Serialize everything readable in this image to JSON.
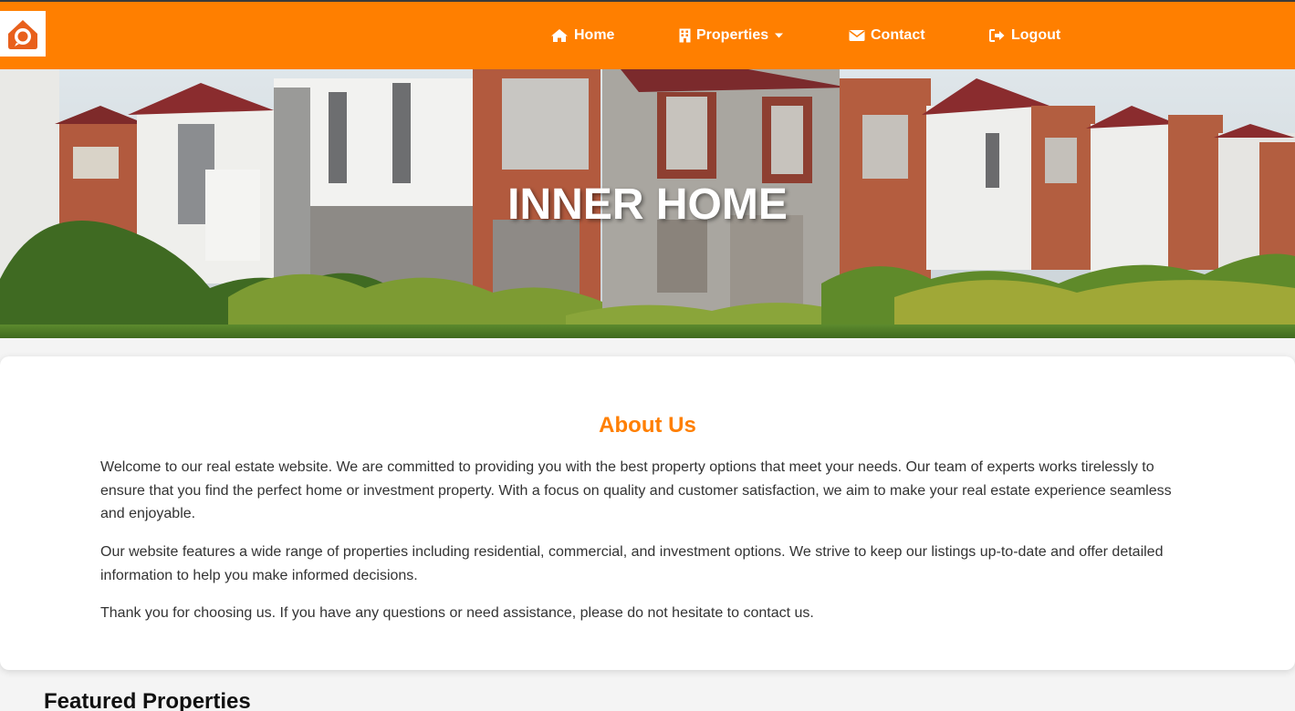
{
  "colors": {
    "accent": "#ff7f00",
    "nav_text": "#ffffff",
    "card_background": "#ffffff",
    "page_background": "#f4f4f4"
  },
  "nav": {
    "logo_icon": "house-chat-logo-icon",
    "items": [
      {
        "label": "Home",
        "icon": "home-icon"
      },
      {
        "label": "Properties",
        "icon": "building-icon",
        "has_dropdown": true
      },
      {
        "label": "Contact",
        "icon": "envelope-icon"
      },
      {
        "label": "Logout",
        "icon": "sign-out-icon"
      }
    ]
  },
  "hero": {
    "title": "INNER HOME"
  },
  "about": {
    "title": "About Us",
    "paragraphs": [
      "Welcome to our real estate website. We are committed to providing you with the best property options that meet your needs. Our team of experts works tirelessly to ensure that you find the perfect home or investment property. With a focus on quality and customer satisfaction, we aim to make your real estate experience seamless and enjoyable.",
      "Our website features a wide range of properties including residential, commercial, and investment options. We strive to keep our listings up-to-date and offer detailed information to help you make informed decisions.",
      "Thank you for choosing us. If you have any questions or need assistance, please do not hesitate to contact us."
    ]
  },
  "featured": {
    "title": "Featured Properties"
  }
}
